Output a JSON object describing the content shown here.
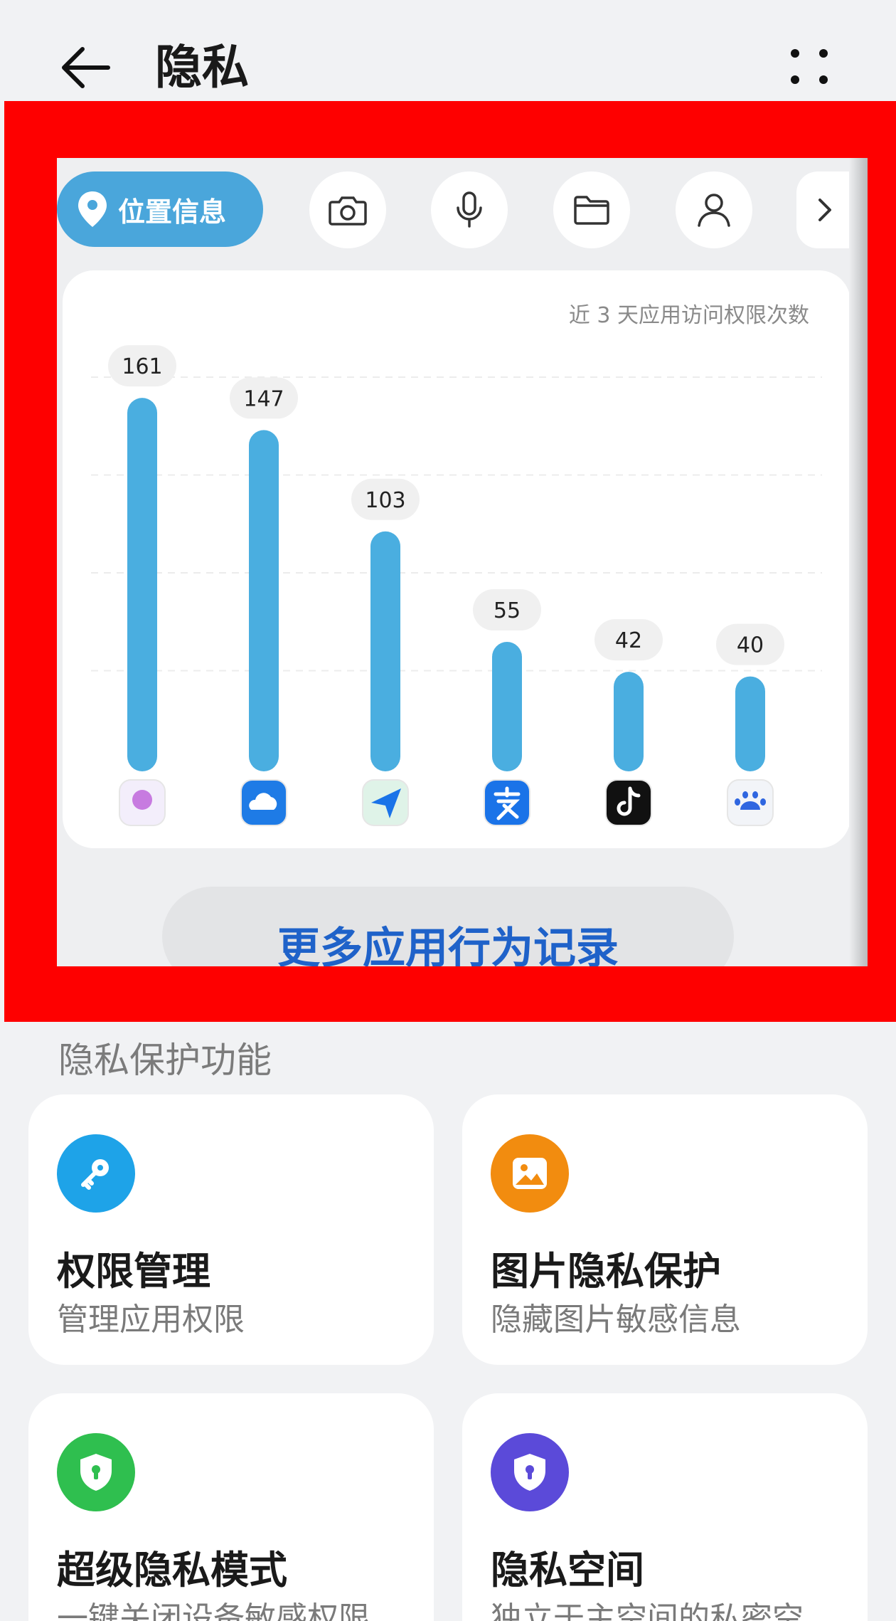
{
  "header": {
    "title": "隐私"
  },
  "categories": {
    "active_label": "位置信息",
    "icons": [
      "location-icon",
      "camera-icon",
      "microphone-icon",
      "folder-icon",
      "contacts-icon",
      "chevron-right-icon"
    ]
  },
  "chart_data": {
    "type": "bar",
    "title": "近 3 天应用访问权限次数",
    "categories": [
      "app-1",
      "app-2",
      "app-3",
      "app-4",
      "app-5",
      "app-6"
    ],
    "values": [
      161,
      147,
      103,
      55,
      42,
      40
    ],
    "value_labels": [
      "161",
      "147",
      "103",
      "55",
      "42",
      "40"
    ],
    "bar_color": "#4aaee0",
    "grid": true,
    "legend": "none",
    "app_icons": [
      "lightbulb-app-icon",
      "weather-app-icon",
      "send-app-icon",
      "alipay-app-icon",
      "tiktok-app-icon",
      "baidu-app-icon"
    ]
  },
  "more_records_label": "更多应用行为记录",
  "section_title": "隐私保护功能",
  "features": [
    {
      "title": "权限管理",
      "subtitle": "管理应用权限",
      "icon": "key-icon",
      "color": "#1ea3e8"
    },
    {
      "title": "图片隐私保护",
      "subtitle": "隐藏图片敏感信息",
      "icon": "image-icon",
      "color": "#f28c0f"
    },
    {
      "title": "超级隐私模式",
      "subtitle": "一键关闭设备敏感权限",
      "icon": "shield-lock-icon",
      "color": "#2fbf4f"
    },
    {
      "title": "隐私空间",
      "subtitle": "独立于主空间的私密空",
      "icon": "shield-lock-icon",
      "color": "#5b4ad9"
    }
  ],
  "colors": {
    "accent": "#4aa6db",
    "link": "#1f62c9",
    "frame": "#fe0000"
  }
}
